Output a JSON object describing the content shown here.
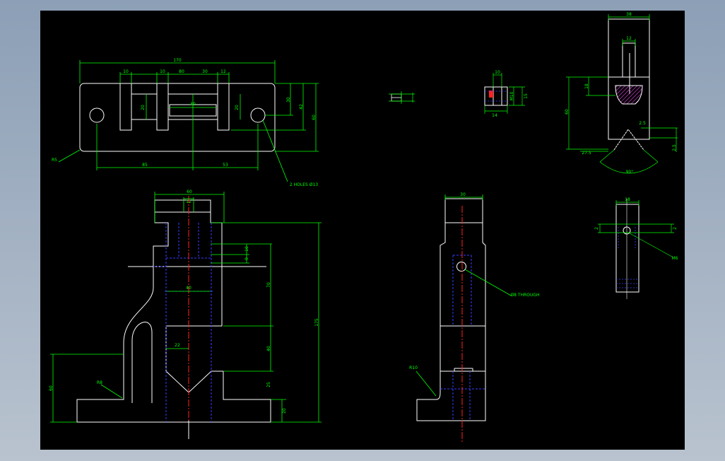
{
  "colors": {
    "background": "#000000",
    "outline": "#ffffff",
    "dimension": "#00ff00",
    "hidden": "#3a3aff",
    "center": "#ff2020",
    "hatch": "#d040d0"
  },
  "top_view": {
    "dim_overall_width": "170",
    "dim_top_1": "10",
    "dim_top_2": "10",
    "dim_top_3": "80",
    "dim_top_4": "30",
    "dim_top_5": "12",
    "dim_slot_height": "20",
    "dim_slot_width": "40",
    "dim_side_20": "20",
    "dim_right_30": "30",
    "dim_right_42": "42",
    "dim_right_60": "60",
    "dim_bottom_85": "85",
    "dim_bottom_53": "53",
    "corner_radius": "R5",
    "holes_note": "2 HOLES Ø13"
  },
  "front_view": {
    "dim_top_60": "60",
    "dim_top_12": "12",
    "dim_10": "10",
    "dim_9": "9",
    "dim_40": "40",
    "dim_22": "22",
    "dim_70": "70",
    "dim_175": "175",
    "dim_40_lower": "40",
    "dim_25": "25",
    "dim_20": "20",
    "dim_left_60": "60",
    "radius_r8": "R8"
  },
  "side_view": {
    "dim_top_30": "30",
    "through_note": "Ø8 THROUGH",
    "radius_r10": "R10"
  },
  "detail_pin": {
    "dim_10": "10",
    "dim_m10": "M10",
    "dim_15": "15",
    "dim_14": "14"
  },
  "detail_jaw": {
    "dim_top_38": "38",
    "dim_12": "12",
    "dim_18": "18",
    "dim_60": "60",
    "dim_2_5_top": "2.5",
    "dim_2_5_right": "2.5",
    "dim_27_5": "27.5",
    "angle": "90°"
  },
  "detail_small": {
    "dim_18": "18",
    "dim_2_left": "2",
    "dim_2_right": "2",
    "thread_note": "M6"
  }
}
